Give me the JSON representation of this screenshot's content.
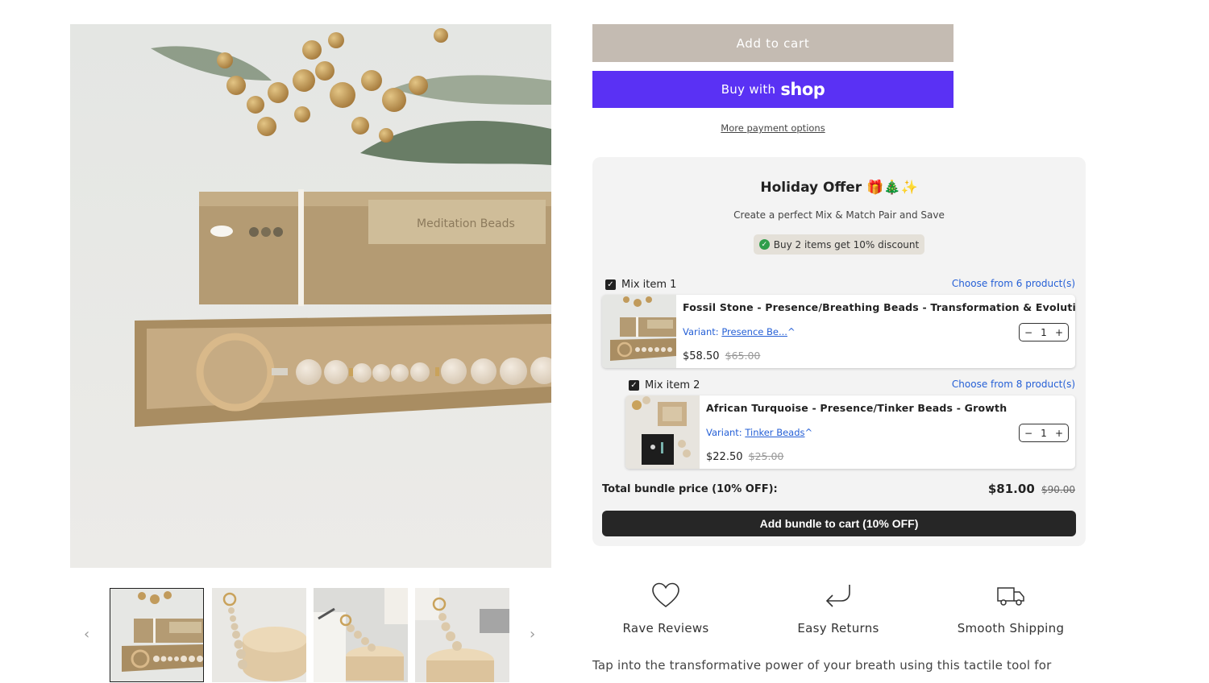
{
  "product": {
    "add_to_cart_label": "Add to cart",
    "buy_with_label": "Buy with",
    "shop_label": "shop",
    "more_payment_label": "More payment options",
    "main_image_text": "Meditation Beads"
  },
  "gallery": {
    "prev_arrow": "‹",
    "next_arrow": "›"
  },
  "bundle": {
    "title": "Holiday Offer 🎁🎄✨",
    "subtitle": "Create a perfect Mix & Match Pair and Save",
    "badge": "Buy 2 items get 10% discount",
    "items": [
      {
        "heading": "Mix item 1",
        "choose_label": "Choose from 6 product(s)",
        "name": "Fossil Stone - Presence/Breathing Beads - Transformation & Evolution",
        "variant_label": "Variant:",
        "variant_value": "Presence Be...",
        "price": "$58.50",
        "compare_price": "$65.00",
        "quantity": "1",
        "checked": true
      },
      {
        "heading": "Mix item 2",
        "choose_label": "Choose from 8 product(s)",
        "name": "African Turquoise - Presence/Tinker Beads - Growth",
        "variant_label": "Variant:",
        "variant_value": "Tinker Beads",
        "price": "$22.50",
        "compare_price": "$25.00",
        "quantity": "1",
        "checked": true
      }
    ],
    "total_label": "Total bundle price (10% OFF):",
    "total_price": "$81.00",
    "total_compare_price": "$90.00",
    "add_bundle_label": "Add bundle to cart (10% OFF)"
  },
  "features": [
    {
      "icon": "heart-icon",
      "label": "Rave Reviews"
    },
    {
      "icon": "return-arrow-icon",
      "label": "Easy Returns"
    },
    {
      "icon": "truck-icon",
      "label": "Smooth Shipping"
    }
  ],
  "description": "Tap into the transformative power of your breath using this tactile tool for",
  "colors": {
    "add_to_cart_bg": "#c4bbb2",
    "shop_pay_bg": "#5a31f4",
    "bundle_bg": "#f3f3f3",
    "link_blue": "#2660d6",
    "bundle_button_bg": "#262626"
  }
}
